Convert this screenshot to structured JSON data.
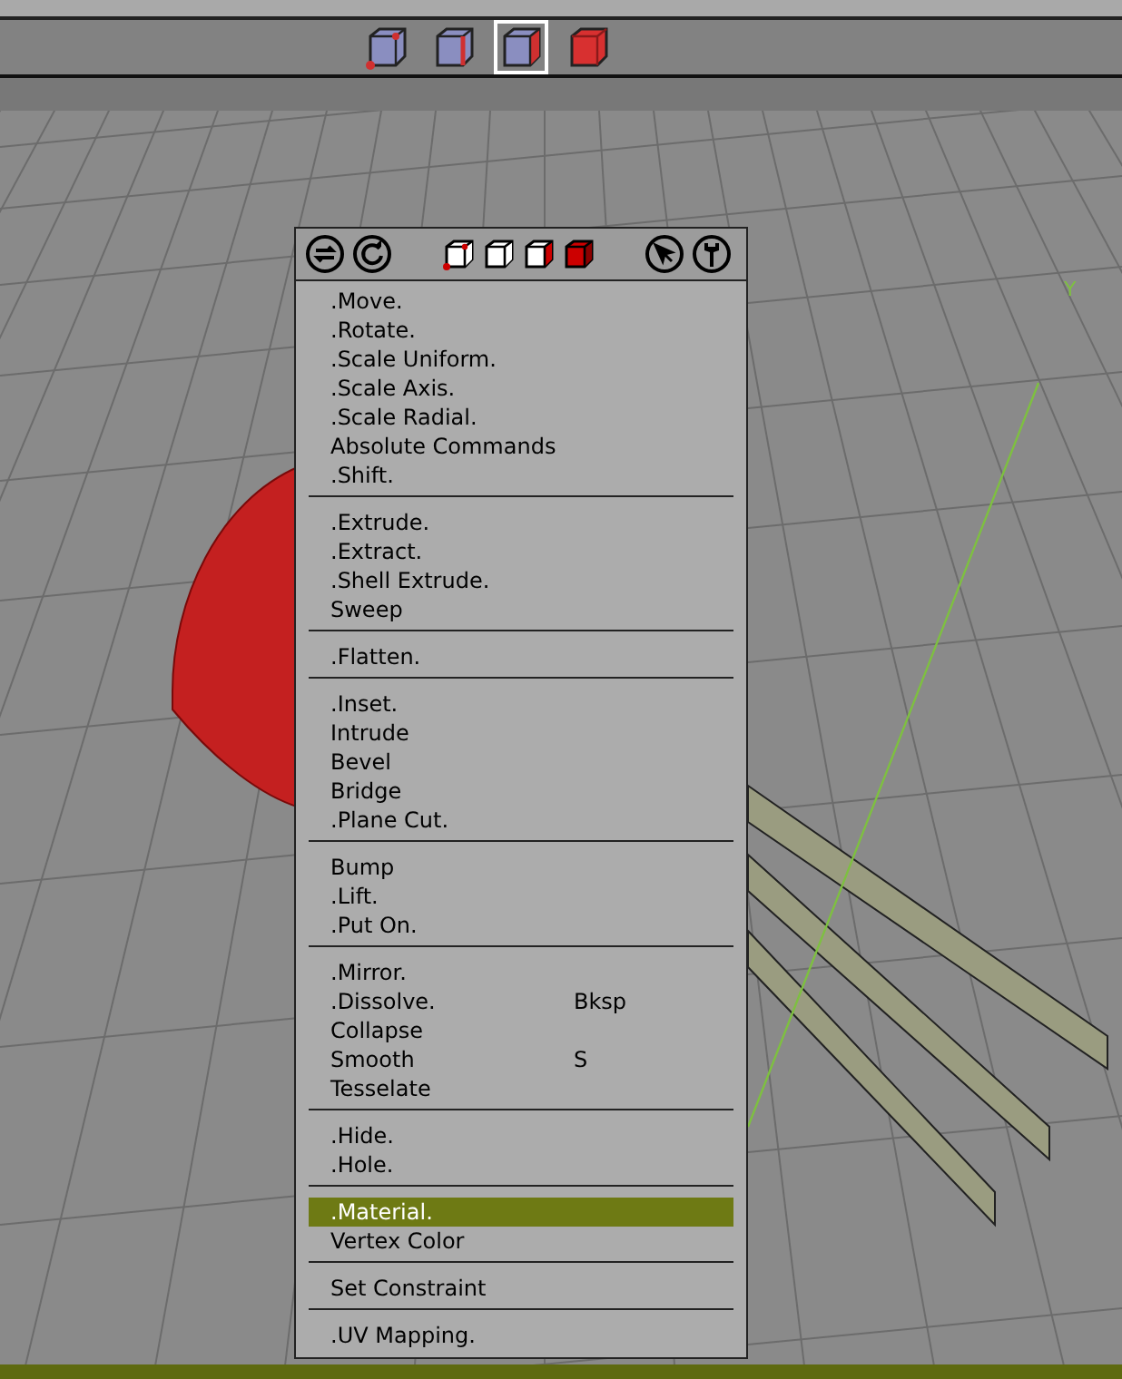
{
  "toolbar": {
    "selection_modes": [
      {
        "kind": "vertex",
        "selected": false
      },
      {
        "kind": "edge",
        "selected": false
      },
      {
        "kind": "face",
        "selected": true
      },
      {
        "kind": "body",
        "selected": false
      }
    ]
  },
  "viewport": {
    "axis_label": "Y"
  },
  "menu": {
    "sections": [
      {
        "items": [
          {
            "label": ".Move.",
            "selected": false
          },
          {
            "label": ".Rotate.",
            "selected": false
          },
          {
            "label": ".Scale Uniform.",
            "selected": false
          },
          {
            "label": ".Scale Axis.",
            "selected": false
          },
          {
            "label": ".Scale Radial.",
            "selected": false
          },
          {
            "label": "Absolute Commands",
            "selected": false
          },
          {
            "label": ".Shift.",
            "selected": false
          }
        ]
      },
      {
        "items": [
          {
            "label": ".Extrude.",
            "selected": false
          },
          {
            "label": ".Extract.",
            "selected": false
          },
          {
            "label": ".Shell Extrude.",
            "selected": false
          },
          {
            "label": "Sweep",
            "selected": false
          }
        ]
      },
      {
        "items": [
          {
            "label": ".Flatten.",
            "selected": false
          }
        ]
      },
      {
        "items": [
          {
            "label": ".Inset.",
            "selected": false
          },
          {
            "label": "Intrude",
            "selected": false
          },
          {
            "label": "Bevel",
            "selected": false
          },
          {
            "label": "Bridge",
            "selected": false
          },
          {
            "label": ".Plane Cut.",
            "selected": false
          }
        ]
      },
      {
        "items": [
          {
            "label": "Bump",
            "selected": false
          },
          {
            "label": ".Lift.",
            "selected": false
          },
          {
            "label": ".Put On.",
            "selected": false
          }
        ]
      },
      {
        "items": [
          {
            "label": ".Mirror.",
            "selected": false
          },
          {
            "label": ".Dissolve.",
            "shortcut": "Bksp",
            "selected": false
          },
          {
            "label": "Collapse",
            "selected": false
          },
          {
            "label": "Smooth",
            "shortcut": "S",
            "selected": false
          },
          {
            "label": "Tesselate",
            "selected": false
          }
        ]
      },
      {
        "items": [
          {
            "label": ".Hide.",
            "selected": false
          },
          {
            "label": ".Hole.",
            "selected": false
          }
        ]
      },
      {
        "items": [
          {
            "label": ".Material.",
            "selected": true
          },
          {
            "label": "Vertex Color",
            "selected": false
          }
        ]
      },
      {
        "items": [
          {
            "label": "Set Constraint",
            "selected": false
          }
        ]
      },
      {
        "items": [
          {
            "label": ".UV Mapping.",
            "selected": false
          }
        ]
      }
    ]
  }
}
